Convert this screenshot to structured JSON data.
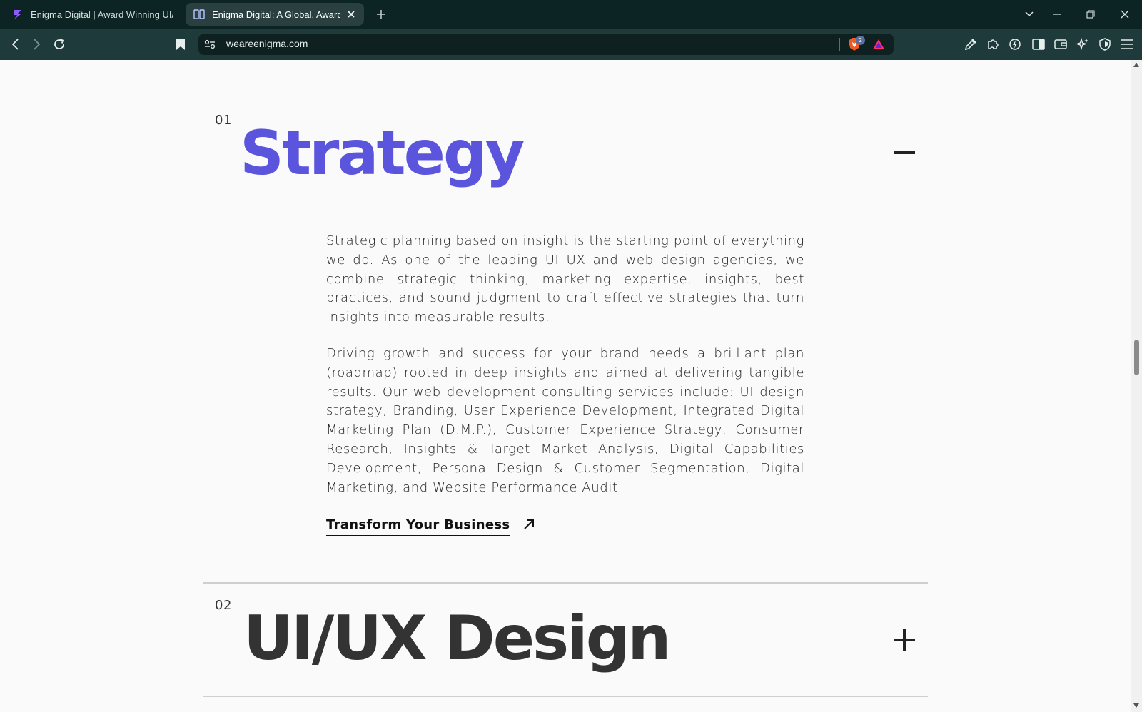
{
  "browser": {
    "tabs": [
      {
        "title": "Enigma Digital | Award Winning UI/U",
        "active": false
      },
      {
        "title": "Enigma Digital: A Global, Award-",
        "active": true
      }
    ],
    "url": "weareenigma.com",
    "shields_count": "2"
  },
  "page": {
    "sections": [
      {
        "number": "01",
        "title": "Strategy",
        "expanded": true,
        "paragraphs": [
          "Strategic planning based on insight is the starting point of everything we do. As one of the leading UI UX and web design agencies, we combine strategic thinking, marketing expertise, insights, best practices, and sound judgment to craft effective strategies that turn insights into measurable results.",
          "Driving growth and success for your brand needs a brilliant plan (roadmap) rooted in deep insights and aimed at delivering tangible results. Our web development consulting services include: UI design strategy, Branding, User Experience Development, Integrated Digital Marketing Plan (D.M.P.), Customer Experience Strategy, Consumer Research, Insights & Target Market Analysis, Digital Capabilities Development, Persona Design & Customer Segmentation, Digital Marketing, and Website Performance Audit."
        ],
        "cta": "Transform Your Business"
      },
      {
        "number": "02",
        "title": "UI/UX Design",
        "expanded": false
      }
    ]
  },
  "colors": {
    "accent": "#5b55dd",
    "heading_dark": "#333333",
    "tabbar_bg": "#0d2424",
    "toolbar_bg": "#1f3a3a"
  }
}
